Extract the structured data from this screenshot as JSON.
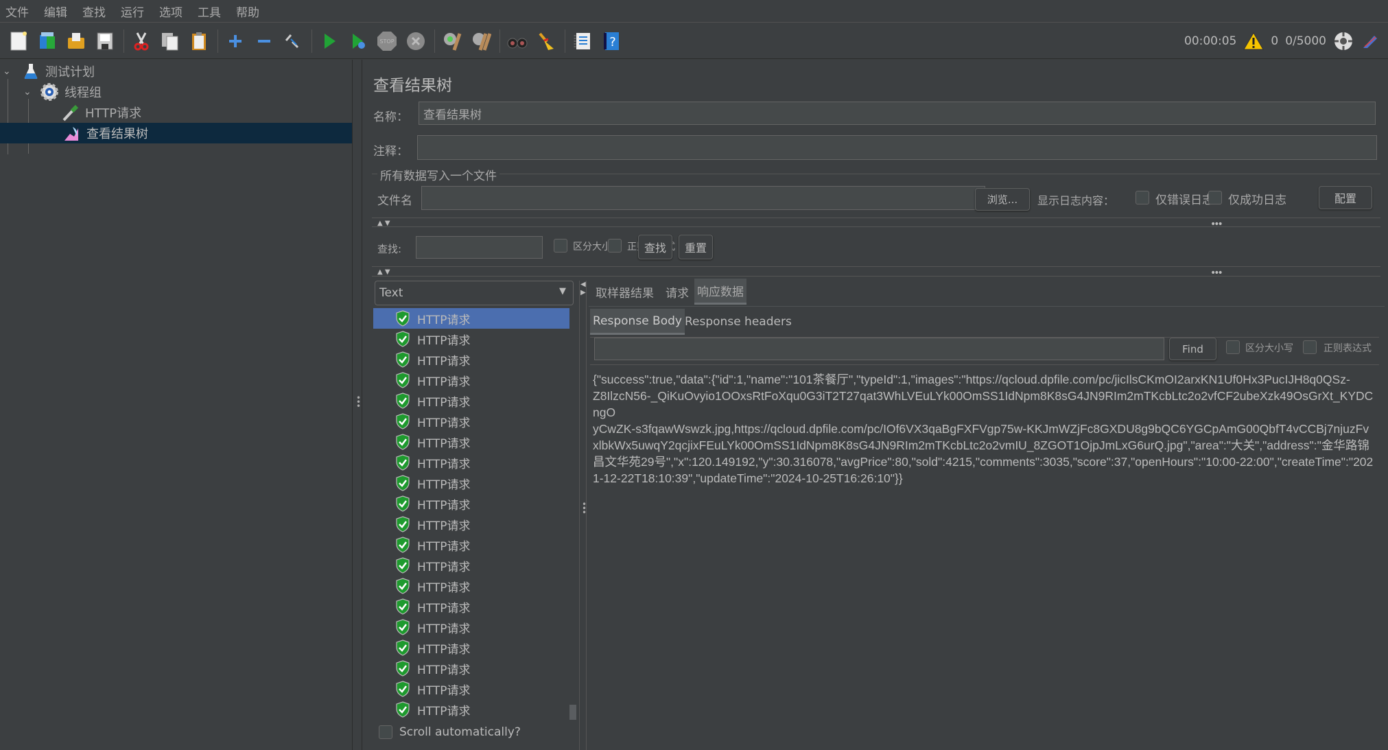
{
  "menu": [
    "文件",
    "编辑",
    "查找",
    "运行",
    "选项",
    "工具",
    "帮助"
  ],
  "toolbar": {
    "icons": [
      "new-icon",
      "templates-icon",
      "open-icon",
      "save-icon",
      "cut-icon",
      "copy-icon",
      "paste-icon",
      "expand-icon",
      "collapse-icon",
      "toggle-icon",
      "start-icon",
      "start-no-pause-icon",
      "stop-icon",
      "shutdown-icon",
      "clear-icon",
      "clear-all-icon",
      "search-icon",
      "reset-search-icon",
      "function-helper-icon",
      "help-icon"
    ],
    "elapsed": "00:00:05",
    "warnings": "0",
    "threads": "0/5000"
  },
  "tree": {
    "items": [
      {
        "label": "测试计划",
        "icon": "test-plan-flask-icon"
      },
      {
        "label": "线程组",
        "icon": "thread-group-gear-icon"
      },
      {
        "label": "HTTP请求",
        "icon": "sampler-pipette-icon"
      },
      {
        "label": "查看结果树",
        "icon": "listener-graph-icon",
        "selected": true
      }
    ]
  },
  "panel": {
    "title": "查看结果树",
    "name_label": "名称：",
    "name_value": "查看结果树",
    "comment_label": "注释：",
    "comment_value": "",
    "file_group_label": "所有数据写入一个文件",
    "filename_label": "文件名",
    "filename_value": "",
    "browse_label": "浏览...",
    "log_label": "显示日志内容：",
    "errors_only_label": "仅错误日志",
    "success_only_label": "仅成功日志",
    "configure_label": "配置",
    "search_label": "查找:",
    "search_value": "",
    "case_sensitive_label": "区分大小写",
    "regex_label": "正则表达式",
    "find_label": "查找",
    "reset_label": "重置"
  },
  "results": {
    "renderer": "Text",
    "items": [
      "HTTP请求",
      "HTTP请求",
      "HTTP请求",
      "HTTP请求",
      "HTTP请求",
      "HTTP请求",
      "HTTP请求",
      "HTTP请求",
      "HTTP请求",
      "HTTP请求",
      "HTTP请求",
      "HTTP请求",
      "HTTP请求",
      "HTTP请求",
      "HTTP请求",
      "HTTP请求",
      "HTTP请求",
      "HTTP请求",
      "HTTP请求",
      "HTTP请求"
    ],
    "scroll_auto_label": "Scroll automatically?"
  },
  "detail": {
    "tabs": [
      "取样器结果",
      "请求",
      "响应数据"
    ],
    "active_tab": 2,
    "subtabs": [
      "Response Body",
      "Response headers"
    ],
    "find_value": "",
    "find_button": "Find",
    "case_label": "区分大小写",
    "regex_label": "正则表达式",
    "body_lines": [
      "{\"success\":true,\"data\":{\"id\":1,\"name\":\"101茶餐厅\",\"typeId\":1,\"images\":\"https://qcloud.dpfile.com/pc/jicIlsCKmOI2arxKN1Uf0Hx3PucIJH8q0QSz-",
      "Z8IlzcN56-_QiKuOvyio1OOxsRtFoXqu0G3iT2T27qat3WhLVEuLYk00OmSS1IdNpm8K8sG4JN9RIm2mTKcbLtc2o2vfCF2ubeXzk49OsGrXt_KYDCngO",
      "yCwZK-s3fqawWswzk.jpg,https://qcloud.dpfile.com/pc/IOf6VX3qaBgFXFVgp75w-KKJmWZjFc8GXDU8g9bQC6YGCpAmG00QbfT4vCCBj7njuzFv",
      "xlbkWx5uwqY2qcjixFEuLYk00OmSS1IdNpm8K8sG4JN9RIm2mTKcbLtc2o2vmIU_8ZGOT1OjpJmLxG6urQ.jpg\",\"area\":\"大关\",\"address\":\"金华路锦",
      "昌文华苑29号\",\"x\":120.149192,\"y\":30.316078,\"avgPrice\":80,\"sold\":4215,\"comments\":3035,\"score\":37,\"openHours\":\"10:00-22:00\",\"createTime\":\"202",
      "1-12-22T18:10:39\",\"updateTime\":\"2024-10-25T16:26:10\"}}"
    ]
  }
}
